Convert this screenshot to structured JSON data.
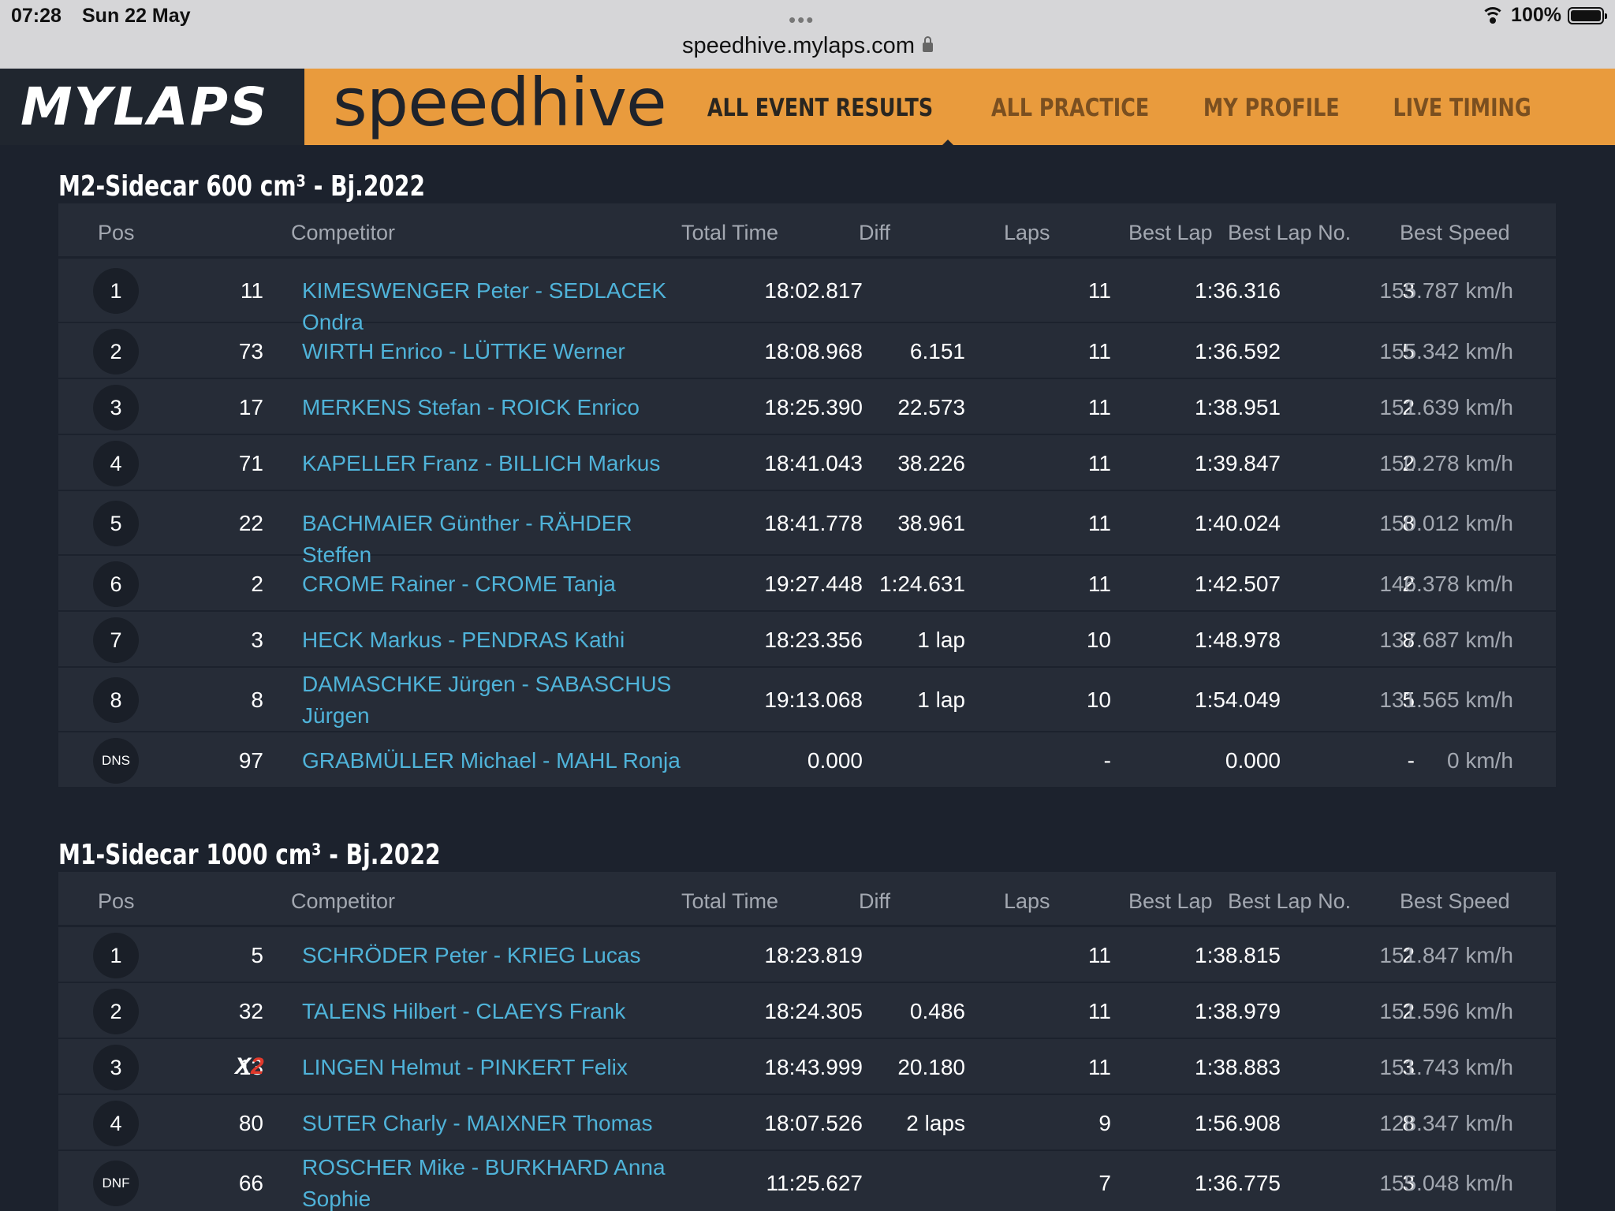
{
  "status": {
    "time": "07:28",
    "date": "Sun 22 May",
    "url": "speedhive.mylaps.com",
    "battery": "100%"
  },
  "header": {
    "logo": "MYLAPS",
    "brand": "speedhive",
    "nav": [
      {
        "label": "ALL EVENT RESULTS",
        "active": true
      },
      {
        "label": "ALL PRACTICE",
        "active": false
      },
      {
        "label": "MY PROFILE",
        "active": false
      },
      {
        "label": "LIVE TIMING",
        "active": false
      }
    ]
  },
  "columns": [
    "Pos",
    "Competitor",
    "Total Time",
    "Diff",
    "Laps",
    "Best Lap",
    "Best Lap No.",
    "Best Speed"
  ],
  "sections": [
    {
      "title": "M2-Sidecar 600 cm³ - Bj.2022",
      "rows": [
        {
          "pos": "1",
          "num": "11",
          "competitor": "KIMESWENGER Peter - SEDLACEK Ondra",
          "total": "18:02.817",
          "diff": "",
          "laps": "11",
          "best_lap": "1:36.316",
          "best_lap_no": "3",
          "best_speed": "155.787 km/h"
        },
        {
          "pos": "2",
          "num": "73",
          "competitor": "WIRTH Enrico - LÜTTKE Werner",
          "total": "18:08.968",
          "diff": "6.151",
          "laps": "11",
          "best_lap": "1:36.592",
          "best_lap_no": "5",
          "best_speed": "155.342 km/h"
        },
        {
          "pos": "3",
          "num": "17",
          "competitor": "MERKENS Stefan - ROICK Enrico",
          "total": "18:25.390",
          "diff": "22.573",
          "laps": "11",
          "best_lap": "1:38.951",
          "best_lap_no": "2",
          "best_speed": "151.639 km/h"
        },
        {
          "pos": "4",
          "num": "71",
          "competitor": "KAPELLER Franz - BILLICH Markus",
          "total": "18:41.043",
          "diff": "38.226",
          "laps": "11",
          "best_lap": "1:39.847",
          "best_lap_no": "2",
          "best_speed": "150.278 km/h"
        },
        {
          "pos": "5",
          "num": "22",
          "competitor": "BACHMAIER Günther - RÄHDER Steffen",
          "total": "18:41.778",
          "diff": "38.961",
          "laps": "11",
          "best_lap": "1:40.024",
          "best_lap_no": "8",
          "best_speed": "150.012 km/h"
        },
        {
          "pos": "6",
          "num": "2",
          "competitor": "CROME Rainer - CROME Tanja",
          "total": "19:27.448",
          "diff": "1:24.631",
          "laps": "11",
          "best_lap": "1:42.507",
          "best_lap_no": "2",
          "best_speed": "146.378 km/h"
        },
        {
          "pos": "7",
          "num": "3",
          "competitor": "HECK Markus - PENDRAS Kathi",
          "total": "18:23.356",
          "diff": "1 lap",
          "laps": "10",
          "best_lap": "1:48.978",
          "best_lap_no": "8",
          "best_speed": "137.687 km/h"
        },
        {
          "pos": "8",
          "num": "8",
          "competitor": "DAMASCHKE Jürgen - SABASCHUS Jürgen",
          "total": "19:13.068",
          "diff": "1 lap",
          "laps": "10",
          "best_lap": "1:54.049",
          "best_lap_no": "5",
          "best_speed": "131.565 km/h"
        },
        {
          "pos": "DNS",
          "num": "97",
          "competitor": "GRABMÜLLER Michael - MAHL Ronja",
          "total": "0.000",
          "diff": "",
          "laps": "-",
          "best_lap": "0.000",
          "best_lap_no": "-",
          "best_speed": "0 km/h"
        }
      ]
    },
    {
      "title": "M1-Sidecar 1000 cm³ - Bj.2022",
      "rows": [
        {
          "pos": "1",
          "num": "5",
          "competitor": "SCHRÖDER Peter - KRIEG Lucas",
          "total": "18:23.819",
          "diff": "",
          "laps": "11",
          "best_lap": "1:38.815",
          "best_lap_no": "2",
          "best_speed": "151.847 km/h"
        },
        {
          "pos": "2",
          "num": "32",
          "competitor": "TALENS Hilbert - CLAEYS Frank",
          "total": "18:24.305",
          "diff": "0.486",
          "laps": "11",
          "best_lap": "1:38.979",
          "best_lap_no": "2",
          "best_speed": "151.596 km/h"
        },
        {
          "pos": "3",
          "num": "13",
          "badge": "X2",
          "competitor": "LINGEN Helmut - PINKERT Felix",
          "total": "18:43.999",
          "diff": "20.180",
          "laps": "11",
          "best_lap": "1:38.883",
          "best_lap_no": "3",
          "best_speed": "151.743 km/h"
        },
        {
          "pos": "4",
          "num": "80",
          "competitor": "SUTER Charly - MAIXNER Thomas",
          "total": "18:07.526",
          "diff": "2 laps",
          "laps": "9",
          "best_lap": "1:56.908",
          "best_lap_no": "8",
          "best_speed": "128.347 km/h"
        },
        {
          "pos": "DNF",
          "num": "66",
          "competitor": "ROSCHER Mike - BURKHARD Anna Sophie",
          "total": "11:25.627",
          "diff": "",
          "laps": "7",
          "best_lap": "1:36.775",
          "best_lap_no": "3",
          "best_speed": "155.048 km/h"
        }
      ]
    }
  ]
}
